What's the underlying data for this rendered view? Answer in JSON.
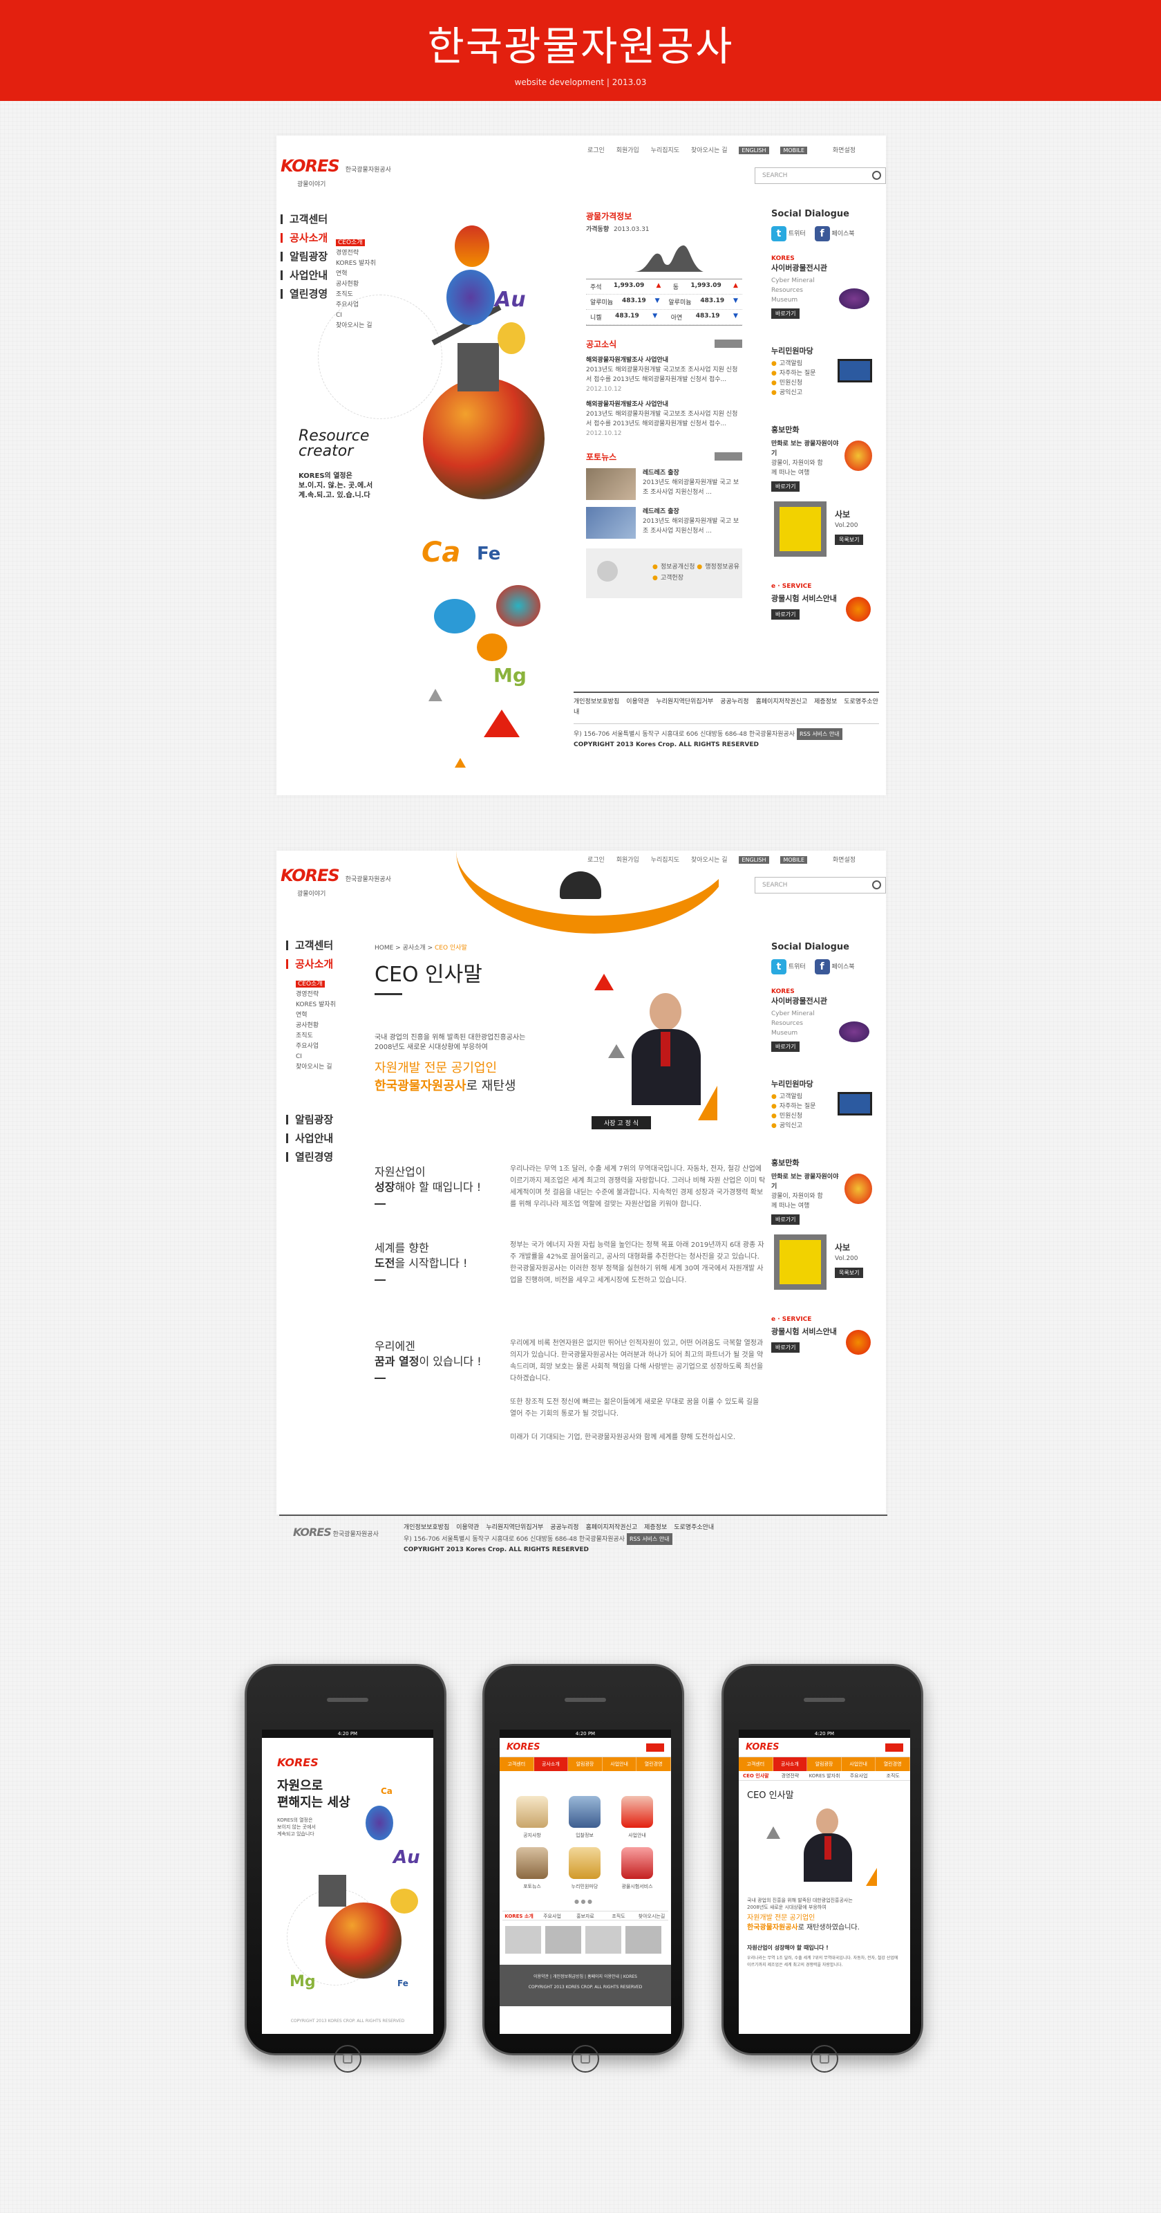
{
  "hero": {
    "title": "한국광물자원공사",
    "subtitle": "website development   |   2013.03"
  },
  "topnav": {
    "items": [
      "로그인",
      "회원가입",
      "누리집지도",
      "찾아오시는 길"
    ],
    "english": "ENGLISH",
    "mobile": "MOBILE",
    "font": "화면설정"
  },
  "search": {
    "placeholder": "SEARCH"
  },
  "logo": {
    "mark": "KORES",
    "sub": "광물이야기",
    "name": "한국광물자원공사"
  },
  "lnb": [
    "고객센터",
    "공사소개",
    "알림광장",
    "사업안내",
    "열린경영"
  ],
  "lnb_sub": [
    "CEO소개",
    "경영전략",
    "KORES 발자취",
    "연혁",
    "공사현황",
    "조직도",
    "주요사업",
    "CI",
    "찾아오시는 길"
  ],
  "main1": {
    "slogan_en": "Resource creator",
    "slogan_ko": "KORES의 열정은\n보.이.지. 않.는. 곳.에.서\n계.속.되.고. 있.습.니.다",
    "elements": [
      "Au",
      "Ca",
      "Fe",
      "Mg"
    ],
    "price": {
      "title": "광물가격정보",
      "label": "가격동향",
      "date": "2013.03.31",
      "rows": [
        [
          "주석",
          "1,993.09",
          "▲",
          "동",
          "1,993.09",
          "▲"
        ],
        [
          "알루미늄",
          "483.19",
          "▼",
          "알루미늄",
          "483.19",
          "▼"
        ],
        [
          "니켈",
          "483.19",
          "▼",
          "아연",
          "483.19",
          "▼"
        ]
      ]
    },
    "notice": {
      "title": "공고소식",
      "items": [
        {
          "head": "해외광물자원개발조사 사업안내",
          "body": "2013년도 해외광물자원개발 국고보조 조사사업 지원 신청서 접수를 2013년도 해외광물자원개발 신청서 접수...",
          "date": "2012.10.12"
        },
        {
          "head": "해외광물자원개발조사 사업안내",
          "body": "2013년도 해외광물자원개발 국고보조 조사사업 지원 신청서 접수를 2013년도 해외광물자원개발 신청서 접수...",
          "date": "2012.10.12"
        }
      ]
    },
    "photo": {
      "title": "포토뉴스",
      "items": [
        {
          "head": "레드레즈 출장",
          "body": "2013년도 해외광물자원개발 국고 보조 조사사업 지원신청서 ..."
        },
        {
          "head": "레드레즈 출장",
          "body": "2013년도 해외광물자원개발 국고 보조 조사사업 지원신청서 ..."
        }
      ]
    },
    "quick": [
      "정보공개신청",
      "행정정보공유",
      "고객헌장"
    ]
  },
  "side": {
    "sns_title": "Social Dialogue",
    "twitter": "트위터",
    "facebook": "페이스북",
    "museum_brand": "KORES",
    "museum_title": "사이버광물전시관",
    "museum_en": "Cyber Mineral Resources Museum",
    "more": "바로가기",
    "nuri_title": "누리민원마당",
    "nuri_items": [
      "고객알림",
      "자주하는 질문",
      "민원신청",
      "공익신고"
    ],
    "promo_title": "홍보만화",
    "promo_line": "만화로 보는 광물자원이야기",
    "promo_desc": "광물이, 자원이와 함께 떠나는 여행",
    "mag_title": "사보",
    "mag_vol": "Vol.200",
    "mag_more": "목록보기",
    "eservice_tag": "e · SERVICE",
    "eservice_title": "광물시험 서비스안내",
    "eservice_more": "바로가기"
  },
  "footer": {
    "links": [
      "개인정보보호방침",
      "이용약관",
      "누리집이메일주소무단수집거부",
      "공공누리",
      "홈페이지운영지침"
    ],
    "links_main1": [
      "개인정보보호방침",
      "이용약관",
      "누리원지역단위집거부",
      "공공누리정",
      "홈페이지저작권신고",
      "제증정보",
      "도로명주소안내"
    ],
    "links_main2": [
      "개인정보보호방침",
      "이용약관",
      "누리원지역단위집거부",
      "공공누리정",
      "홈페이지저작권신고",
      "제증정보",
      "도로명주소안내"
    ],
    "address": "우) 156-706 서울특별시 동작구 시흥대로 606 신대방동 686-48 한국광물자원공사",
    "badge": "RSS 서비스 안내",
    "copyright": "COPYRIGHT 2013 Kores Crop.  ALL RIGHTS RESERVED"
  },
  "main2": {
    "breadcrumb": [
      "HOME",
      "공사소개",
      "CEO 인사말"
    ],
    "title": "CEO 인사말",
    "intro": "국내 광업의 진흥을 위해 발족된 대한광업진흥공사는\n2008년도 새로운 시대상황에 부응하여",
    "tag1": "자원개발 전문 공기업인",
    "tag2": "한국광물자원공사",
    "tag3": "로 재탄생",
    "ceo_label": "사장  고 정 식",
    "blocks": [
      {
        "h1": "자원산업이",
        "h2": "성장",
        "h3": "해야 할 때입니다 !",
        "body": "우리나라는 무역 1조 달러, 수출 세계 7위의 무역대국입니다. 자동차, 전자, 철강 산업에 이르기까지 제조업은 세계 최고의 경쟁력을 자랑합니다. 그러나 비해 자원 산업은 이미 탁 세계적이며 첫 걸음을 내딛는 수준에 불과합니다. 지속적인 경제 성장과 국가경쟁력 확보를 위해 우리나라 제조업 역할에 걸맞는 자원산업을 키워야 합니다."
      },
      {
        "h1": "세계를 향한",
        "h2": "도전",
        "h3": "을 시작합니다 !",
        "body": "정부는 국가 에너지 자원 자립 능력을 높인다는 정책 목표 아래 2019년까지 6대 광종 자주 개발률을 42%로 끌어올리고, 공사의 대형화를 추진한다는 청사진을 갖고 있습니다. 한국광물자원공사는 이러한 정부 정책을 실현하기 위해 세계 30여 개국에서 자원개발 사업을 진행하며, 비전을 세우고 세계시장에 도전하고 있습니다."
      },
      {
        "h1": "우리에겐",
        "h2": "꿈과 열정",
        "h3": "이 있습니다 !",
        "body": "우리에게 비록 천연자원은 없지만 뛰어난 인적자원이 있고, 어떤 어려움도 극복할 열정과 의지가 있습니다. 한국광물자원공사는 여러분과 하나가 되어 최고의 파트너가 될 것을 약속드리며, 희망 보호는 물론 사회적 책임을 다해 사랑받는 공기업으로 성장하도록 최선을 다하겠습니다.\n\n또한 창조적 도전 정신에 빠르는 젊은이들에게 새로운 무대로 꿈을 이룰 수 있도록 길을 열어 주는 기회의 통로가 될 것입니다.\n\n미래가 더 기대되는 기업, 한국광물자원공사와 함께 세계를 향해 도전하십시오."
      }
    ]
  },
  "mobile": {
    "status": "4:20 PM",
    "p1": {
      "brand": "KORES",
      "headline": "자원으로\n편해지는 세상",
      "copy": "KORES의 열정은\n보이지 않는 곳에서\n계속되고 있습니다",
      "elements": [
        "Au",
        "Mg",
        "Ca",
        "Fe"
      ],
      "copyright": "COPYRIGHT 2013 KORES CROP.  ALL RIGHTS RESERVED"
    },
    "p2": {
      "brand": "KORES",
      "nav": [
        "고객센터",
        "공사소개",
        "알림광장",
        "사업안내",
        "열린경영"
      ],
      "on": 1,
      "icons": [
        "공지사항",
        "입찰정보",
        "사업안내",
        "포토뉴스",
        "누리민원마당",
        "광물시험서비스"
      ],
      "tabs": [
        "KORES 소개",
        "주요사업",
        "홍보자료",
        "조직도",
        "찾아오시는길"
      ],
      "footer_links": [
        "이용약관",
        "개인정보취급방침",
        "홈페이지 이용안내",
        "KORES"
      ],
      "copyright": "COPYRIGHT 2013 KORES CROP.  ALL RIGHTS RESERVED"
    },
    "p3": {
      "brand": "KORES",
      "nav": [
        "고객센터",
        "공사소개",
        "알림광장",
        "사업안내",
        "열린경영"
      ],
      "on": 1,
      "subnav": [
        "CEO 인사말",
        "경영전략",
        "KORES 발자취",
        "주요사업",
        "조직도"
      ],
      "title": "CEO 인사말",
      "intro": "국내 광업의 진흥을 위해 발족된 대한광업진흥공사는\n2008년도 새로운 시대상황에 부응하여",
      "tag1": "자원개발 전문 공기업인",
      "tag2": "한국광물자원공사",
      "tag3": "로 재탄생하였습니다.",
      "sub_head": "자원산업이 성장해야 할 때입니다 !",
      "body": "우리나라는 무역 1조 달러, 수출 세계 7위의 무역대국입니다. 자동차, 전자, 철강 산업에 이르기까지 제조업은 세계 최고의 경쟁력을 자랑합니다."
    }
  }
}
